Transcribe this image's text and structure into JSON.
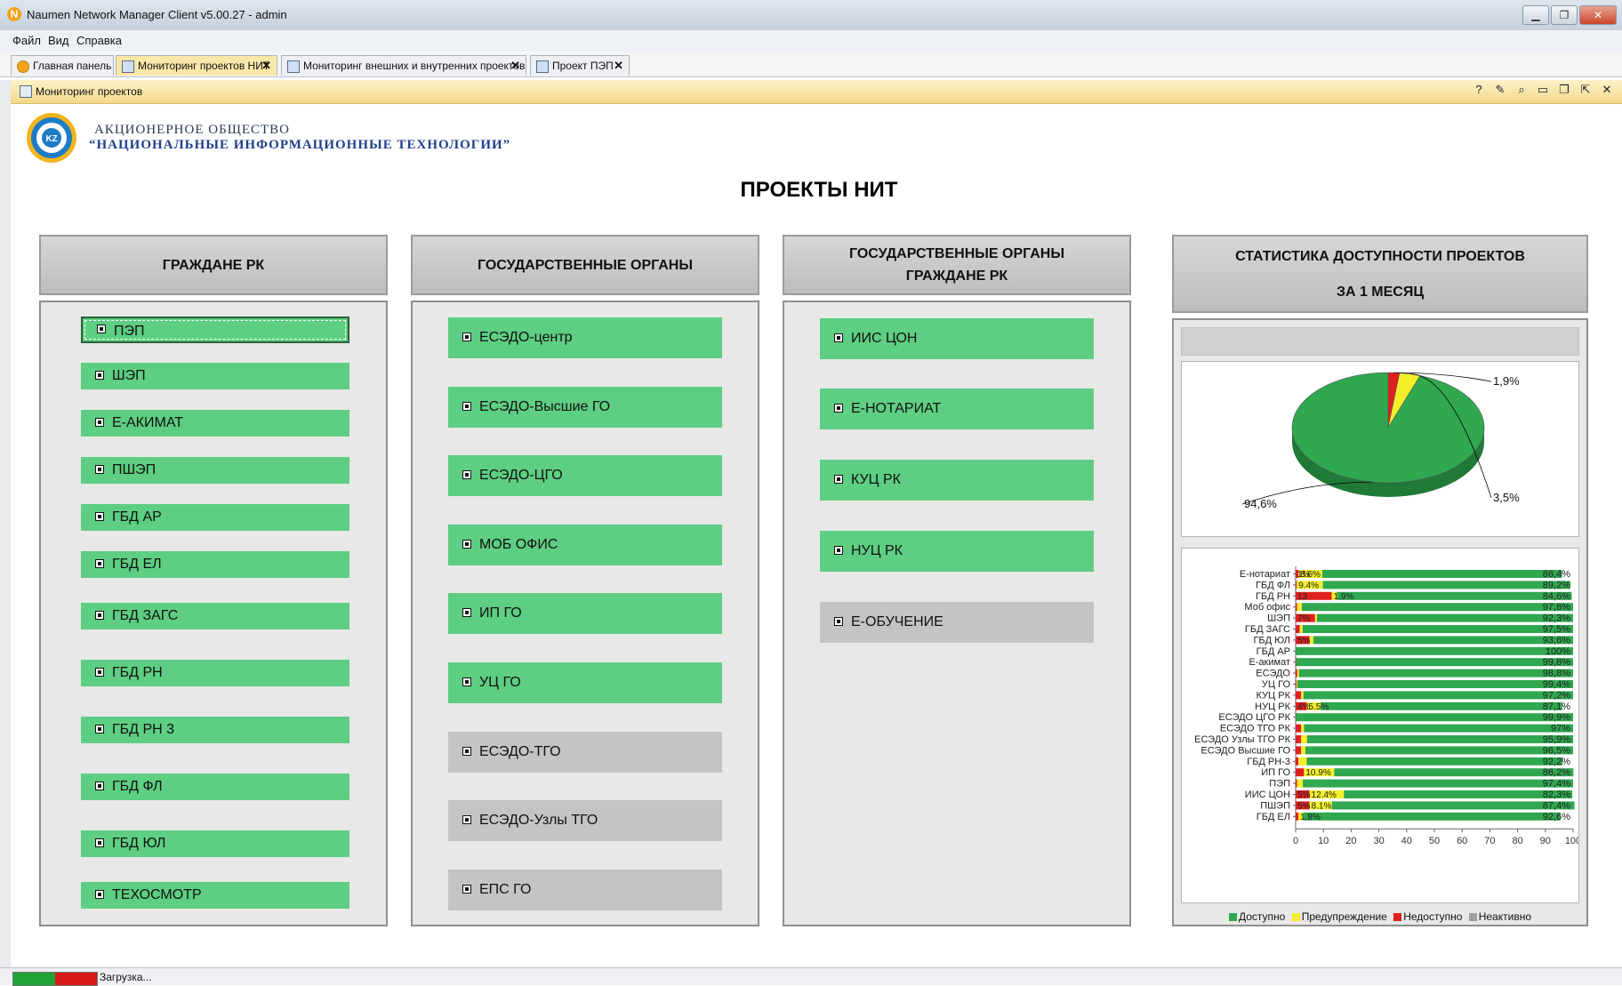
{
  "window": {
    "title": "Naumen Network Manager Client v5.00.27 - admin"
  },
  "menu": [
    "Файл",
    "Вид",
    "Справка"
  ],
  "tabs": [
    {
      "label": "Главная панель",
      "closable": false
    },
    {
      "label": "Мониторинг проектов НИТ",
      "closable": true,
      "active": true
    },
    {
      "label": "Мониторинг внешних и внутренних проектов",
      "closable": true
    },
    {
      "label": "Проект ПЭП",
      "closable": true
    }
  ],
  "panel": {
    "title": "Мониторинг проектов"
  },
  "org": {
    "line1": "АКЦИОНЕРНОЕ ОБЩЕСТВО",
    "line2": "“НАЦИОНАЛЬНЫЕ ИНФОРМАЦИОННЫЕ ТЕХНОЛОГИИ”",
    "logo_text": "KZ"
  },
  "main_title": "ПРОЕКТЫ НИТ",
  "columns": [
    {
      "header": [
        "ГРАЖДАНЕ РК"
      ],
      "items": [
        {
          "label": "ПЭП",
          "status": "available",
          "selected": true
        },
        {
          "label": "ШЭП",
          "status": "available"
        },
        {
          "label": "Е-АКИМАТ",
          "status": "available"
        },
        {
          "label": "ПШЭП",
          "status": "available"
        },
        {
          "label": "ГБД АР",
          "status": "available"
        },
        {
          "label": "ГБД ЕЛ",
          "status": "available"
        },
        {
          "label": "ГБД ЗАГС",
          "status": "available"
        },
        {
          "label": "ГБД РН",
          "status": "available"
        },
        {
          "label": "ГБД РН 3",
          "status": "available"
        },
        {
          "label": "ГБД ФЛ",
          "status": "available"
        },
        {
          "label": "ГБД ЮЛ",
          "status": "available"
        },
        {
          "label": "ТЕХОСМОТР",
          "status": "available"
        }
      ]
    },
    {
      "header": [
        "ГОСУДАРСТВЕННЫЕ ОРГАНЫ"
      ],
      "items": [
        {
          "label": "ЕСЭДО-центр",
          "status": "available"
        },
        {
          "label": "ЕСЭДО-Высшие ГО",
          "status": "available"
        },
        {
          "label": "ЕСЭДО-ЦГО",
          "status": "available"
        },
        {
          "label": "МОБ ОФИС",
          "status": "available"
        },
        {
          "label": "ИП ГО",
          "status": "available"
        },
        {
          "label": "УЦ ГО",
          "status": "available"
        },
        {
          "label": "ЕСЭДО-ТГО",
          "status": "inactive"
        },
        {
          "label": "ЕСЭДО-Узлы ТГО",
          "status": "inactive"
        },
        {
          "label": "ЕПС ГО",
          "status": "inactive"
        }
      ]
    },
    {
      "header": [
        "ГОСУДАРСТВЕННЫЕ ОРГАНЫ",
        "ГРАЖДАНЕ РК"
      ],
      "items": [
        {
          "label": "ИИС ЦОН",
          "status": "available"
        },
        {
          "label": "Е-НОТАРИАТ",
          "status": "available"
        },
        {
          "label": "КУЦ РК",
          "status": "available"
        },
        {
          "label": "НУЦ РК",
          "status": "available"
        },
        {
          "label": "Е-ОБУЧЕНИЕ",
          "status": "inactive"
        }
      ]
    }
  ],
  "stats": {
    "header": [
      "СТАТИСТИКА ДОСТУПНОСТИ ПРОЕКТОВ",
      "ЗА 1 МЕСЯЦ"
    ],
    "pie_labels": {
      "available": "94,6%",
      "warning": "3,5%",
      "unavailable": "1,9%"
    },
    "legend": [
      "Доступно",
      "Предупреждение",
      "Недоступно",
      "Неактивно"
    ]
  },
  "colors": {
    "available": "#2fa84f",
    "warning": "#f4ef2a",
    "unavailable": "#e02020",
    "inactive": "#a0a0a0",
    "item_green": "#5ece82",
    "item_gray": "#c4c4c4"
  },
  "chart_data": [
    {
      "type": "pie",
      "categories": [
        "Доступно",
        "Предупреждение",
        "Недоступно"
      ],
      "values": [
        94.6,
        3.5,
        1.9
      ],
      "labels": [
        "94,6%",
        "3,5%",
        "1,9%"
      ]
    },
    {
      "type": "bar",
      "stacked": true,
      "orientation": "horizontal",
      "categories": [
        "Е-нотариат",
        "ГБД ФЛ",
        "ГБД РН",
        "Моб офис",
        "ШЭП",
        "ГБД ЗАГС",
        "ГБД ЮЛ",
        "ГБД АР",
        "Е-акимат",
        "ЕСЭДО",
        "УЦ ГО",
        "КУЦ РК",
        "НУЦ РК",
        "ЕСЭДО ЦГО РК",
        "ЕСЭДО ТГО РК",
        "ЕСЭДО Узлы ТГО РК",
        "ЕСЭДО Высшие ГО",
        "ГБД РН-3",
        "ИП ГО",
        "ПЭП",
        "ИИС ЦОН",
        "ПШЭП",
        "ГБД ЕЛ"
      ],
      "series": [
        {
          "name": "Недоступно",
          "values": [
            1.0,
            0.4,
            13.0,
            0.5,
            7.0,
            1.5,
            5.0,
            0,
            0.2,
            0.6,
            0.3,
            2.0,
            4.0,
            0.1,
            2.0,
            2.0,
            2.0,
            1.0,
            3.0,
            0.5,
            5.0,
            5.0,
            1.0
          ],
          "labels": [
            "1%",
            "",
            "13",
            "",
            "7%",
            "",
            "5%",
            "",
            "",
            "",
            "",
            "",
            "4%",
            "",
            "",
            "",
            "",
            "",
            "",
            "",
            "5%",
            "5%",
            ""
          ]
        },
        {
          "name": "Предупреждение",
          "values": [
            8.6,
            9.4,
            1.9,
            1.7,
            0.7,
            1.0,
            1.4,
            0,
            0,
            0.6,
            0.3,
            0.8,
            5.0,
            0,
            1.0,
            2.1,
            1.5,
            3.0,
            10.9,
            2.1,
            12.4,
            8.1,
            1.8
          ],
          "labels": [
            "8.6%",
            "9.4%",
            "1.9%",
            "",
            "",
            "",
            "",
            "",
            "",
            "",
            "",
            "",
            "5.5%",
            "",
            "",
            "",
            "",
            "",
            "10.9%",
            "",
            "12.4%",
            "8.1%",
            "1.8%"
          ]
        },
        {
          "name": "Доступно",
          "values": [
            86.4,
            89.2,
            84.6,
            97.8,
            92.3,
            97.5,
            93.6,
            100,
            99.8,
            98.8,
            99.4,
            97.2,
            87.1,
            99.9,
            97,
            95.9,
            96.5,
            92.2,
            86.2,
            97.4,
            82.3,
            87.4,
            92.6
          ],
          "labels": [
            "86,4%",
            "89,2%",
            "84,6%",
            "97,8%",
            "92,3%",
            "97,5%",
            "93,6%",
            "100%",
            "99,8%",
            "98,8%",
            "99,4%",
            "97,2%",
            "87,1%",
            "99,9%",
            "97%",
            "95,9%",
            "96,5%",
            "92,2%",
            "86,2%",
            "97,4%",
            "82,3%",
            "87,4%",
            "92,6%"
          ]
        }
      ],
      "xticks": [
        "0",
        "10",
        "20",
        "30",
        "40",
        "50",
        "60",
        "70",
        "80",
        "90",
        "100"
      ],
      "xlim": [
        0,
        100
      ]
    }
  ],
  "status": {
    "text": "Загрузка..."
  }
}
